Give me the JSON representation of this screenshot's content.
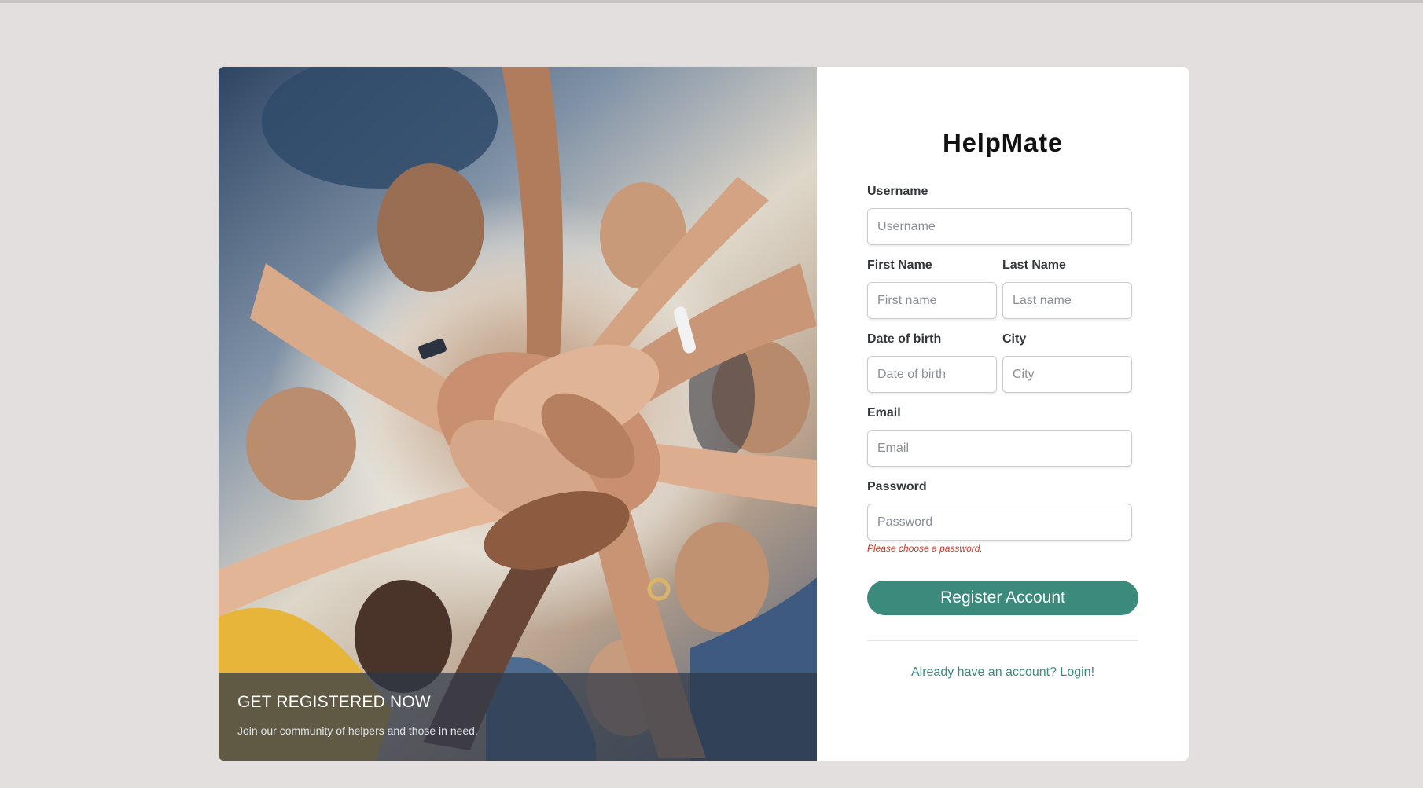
{
  "hero": {
    "caption_title": "GET REGISTERED NOW",
    "caption_subtitle": "Join our community of helpers and those in need."
  },
  "brand": {
    "name": "HelpMate"
  },
  "form": {
    "username": {
      "label": "Username",
      "placeholder": "Username",
      "value": ""
    },
    "first_name": {
      "label": "First Name",
      "placeholder": "First name",
      "value": ""
    },
    "last_name": {
      "label": "Last Name",
      "placeholder": "Last name",
      "value": ""
    },
    "date_of_birth": {
      "label": "Date of birth",
      "placeholder": "Date of birth",
      "value": ""
    },
    "city": {
      "label": "City",
      "placeholder": "City",
      "value": ""
    },
    "email": {
      "label": "Email",
      "placeholder": "Email",
      "value": ""
    },
    "password": {
      "label": "Password",
      "placeholder": "Password",
      "value": "",
      "error": "Please choose a password."
    },
    "submit_label": "Register Account",
    "login_link": "Already have an account? Login!"
  },
  "colors": {
    "page_background": "#e3dfdf",
    "accent": "#3b8a7c",
    "link": "#3d8a80",
    "error": "#c0392b",
    "caption_overlay": "#2d3748"
  }
}
